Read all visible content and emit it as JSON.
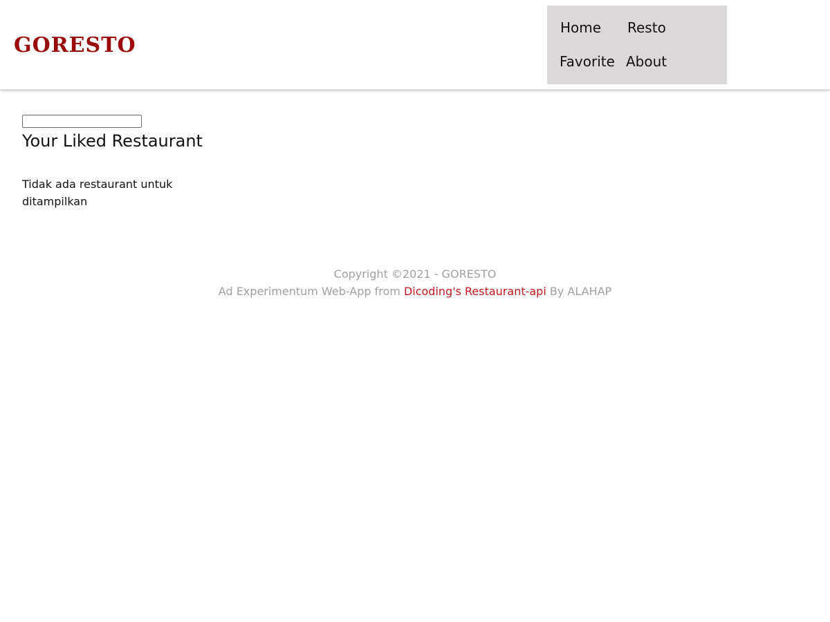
{
  "header": {
    "brand": "GORESTO",
    "nav": {
      "home": "Home",
      "resto": "Resto",
      "favorite": "Favorite",
      "about": "About"
    }
  },
  "main": {
    "search": {
      "value": "",
      "placeholder": ""
    },
    "title": "Your Liked Restaurant",
    "empty_message": "Tidak ada restaurant untuk ditampilkan"
  },
  "footer": {
    "copyright": "Copyright ©2021 - GORESTO",
    "credit_prefix": "Ad Experimentum Web-App from",
    "credit_link": "Dicoding's Restaurant-api",
    "credit_suffix": "By ALAHAP"
  },
  "colors": {
    "brand": "#9a0b0b",
    "nav_background": "#dcd8d7",
    "footer_text": "#a0a0a0",
    "footer_link": "#c4161c"
  }
}
